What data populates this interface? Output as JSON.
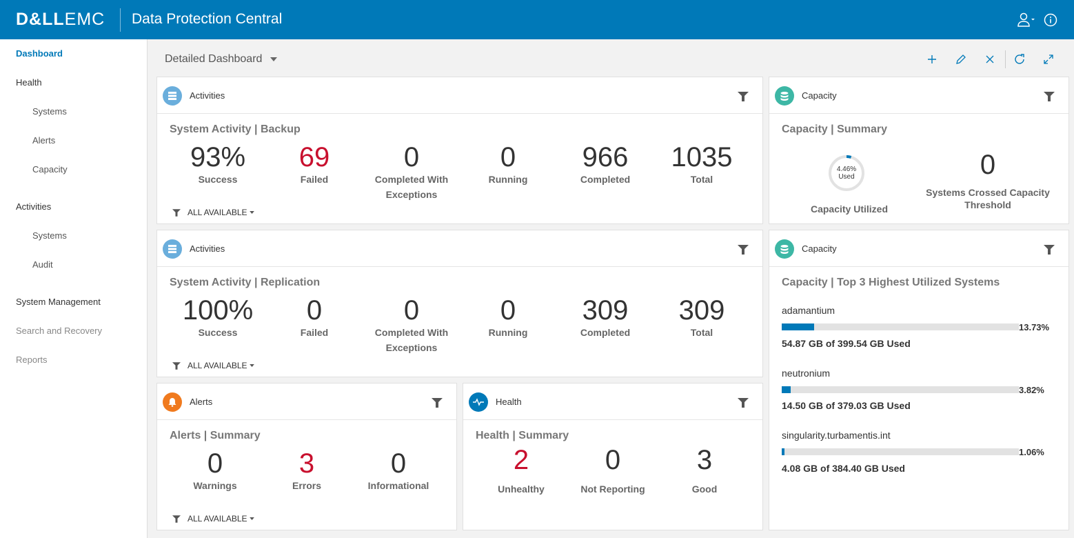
{
  "header": {
    "brand_dell": "D&LL",
    "brand_emc": "EMC",
    "title": "Data Protection Central",
    "user_icon": "user-icon",
    "info_icon": "info-icon"
  },
  "sidebar": {
    "items": [
      {
        "label": "Dashboard"
      },
      {
        "label": "Health"
      },
      {
        "label": "Systems"
      },
      {
        "label": "Alerts"
      },
      {
        "label": "Capacity"
      },
      {
        "label": "Activities"
      },
      {
        "label": "Systems"
      },
      {
        "label": "Audit"
      },
      {
        "label": "System Management"
      },
      {
        "label": "Search and Recovery"
      },
      {
        "label": "Reports"
      }
    ]
  },
  "toolbar": {
    "dashboard_select": "Detailed Dashboard",
    "icons": [
      "plus-icon",
      "pencil-icon",
      "close-icon",
      "refresh-icon",
      "expand-icon"
    ]
  },
  "backup": {
    "card_title": "Activities",
    "section": "System Activity | Backup",
    "filter": "ALL AVAILABLE",
    "metrics": [
      {
        "value": "93%",
        "label": "Success"
      },
      {
        "value": "69",
        "label": "Failed"
      },
      {
        "value": "0",
        "label": "Completed With Exceptions"
      },
      {
        "value": "0",
        "label": "Running"
      },
      {
        "value": "966",
        "label": "Completed"
      },
      {
        "value": "1035",
        "label": "Total"
      }
    ]
  },
  "replication": {
    "card_title": "Activities",
    "section": "System Activity | Replication",
    "filter": "ALL AVAILABLE",
    "metrics": [
      {
        "value": "100%",
        "label": "Success"
      },
      {
        "value": "0",
        "label": "Failed"
      },
      {
        "value": "0",
        "label": "Completed With Exceptions"
      },
      {
        "value": "0",
        "label": "Running"
      },
      {
        "value": "309",
        "label": "Completed"
      },
      {
        "value": "309",
        "label": "Total"
      }
    ]
  },
  "alerts": {
    "card_title": "Alerts",
    "section": "Alerts | Summary",
    "filter": "ALL AVAILABLE",
    "metrics": [
      {
        "value": "0",
        "label": "Warnings"
      },
      {
        "value": "3",
        "label": "Errors"
      },
      {
        "value": "0",
        "label": "Informational"
      }
    ]
  },
  "health": {
    "card_title": "Health",
    "section": "Health | Summary",
    "metrics": [
      {
        "value": "2",
        "label": "Unhealthy"
      },
      {
        "value": "0",
        "label": "Not Reporting"
      },
      {
        "value": "3",
        "label": "Good"
      }
    ]
  },
  "capacity_summary": {
    "card_title": "Capacity",
    "section": "Capacity | Summary",
    "donut_pct": "4.46%",
    "donut_used": "Used",
    "donut_fraction": 0.0446,
    "utilized_label": "Capacity Utilized",
    "crossed_value": "0",
    "crossed_label": "Systems Crossed Capacity Threshold"
  },
  "capacity_top": {
    "card_title": "Capacity",
    "section": "Capacity | Top 3 Highest Utilized Systems",
    "systems": [
      {
        "name": "adamantium",
        "pct": "13.73%",
        "fraction": 0.1373,
        "used": "54.87 GB of 399.54 GB Used"
      },
      {
        "name": "neutronium",
        "pct": "3.82%",
        "fraction": 0.0382,
        "used": "14.50 GB of 379.03 GB Used"
      },
      {
        "name": "singularity.turbamentis.int",
        "pct": "1.06%",
        "fraction": 0.0106,
        "used": "4.08 GB of 384.40 GB Used"
      }
    ]
  },
  "colors": {
    "brand": "#0079b8",
    "error": "#c8102e",
    "activities_icon": "#6aaedc",
    "capacity_icon": "#3db7a5",
    "alerts_icon": "#f07a1e",
    "health_icon": "#0079b8"
  }
}
